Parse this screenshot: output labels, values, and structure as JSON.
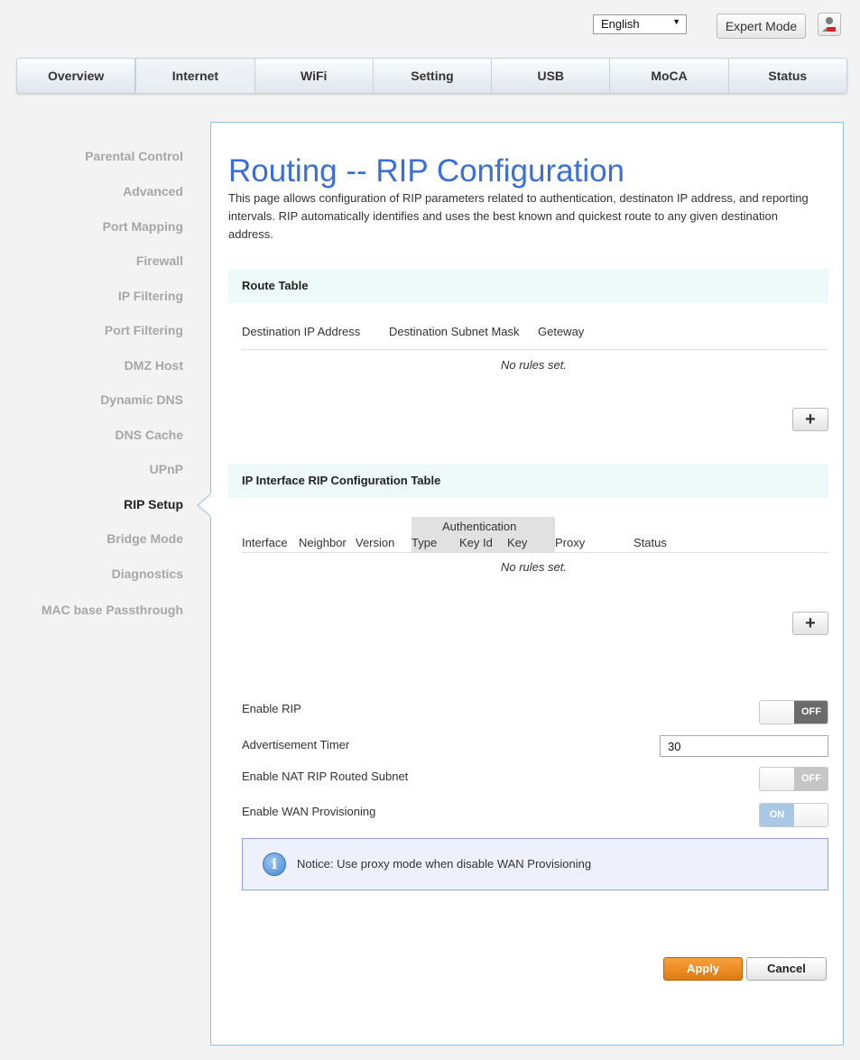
{
  "header": {
    "language": "English",
    "expert_mode_label": "Expert Mode"
  },
  "nav": {
    "tabs": [
      "Overview",
      "Internet",
      "WiFi",
      "Setting",
      "USB",
      "MoCA",
      "Status"
    ],
    "active": "Internet"
  },
  "sidebar": {
    "items": [
      "Parental Control",
      "Advanced",
      "Port Mapping",
      "Firewall",
      "IP Filtering",
      "Port Filtering",
      "DMZ Host",
      "Dynamic DNS",
      "DNS Cache",
      "UPnP",
      "RIP Setup",
      "Bridge Mode",
      "Diagnostics",
      "MAC base Passthrough"
    ],
    "active": "RIP Setup"
  },
  "page": {
    "title": "Routing -- RIP Configuration",
    "description": "This page allows configuration of RIP parameters related to authentication, destinaton IP address, and reporting intervals. RIP automatically identifies and uses the best known and quickest route to any given destination address."
  },
  "route_table": {
    "title": "Route Table",
    "columns": [
      "Destination IP Address",
      "Destination Subnet Mask",
      "Geteway"
    ],
    "empty_text": "No rules set.",
    "add_label": "+"
  },
  "rip_table": {
    "title": "IP Interface RIP Configuration Table",
    "group_header": "Authentication",
    "columns": [
      "Interface",
      "Neighbor",
      "Version",
      "Type",
      "Key Id",
      "Key",
      "Proxy",
      "Status"
    ],
    "empty_text": "No rules set.",
    "add_label": "+"
  },
  "settings": {
    "enable_rip": {
      "label": "Enable RIP",
      "state": "OFF"
    },
    "advertisement_timer": {
      "label": "Advertisement Timer",
      "value": "30"
    },
    "enable_nat": {
      "label": "Enable NAT RIP Routed Subnet",
      "state": "OFF"
    },
    "enable_wan": {
      "label": "Enable WAN Provisioning",
      "state": "ON"
    }
  },
  "notice": {
    "text": "Notice: Use proxy mode when disable WAN Provisioning"
  },
  "actions": {
    "apply": "Apply",
    "cancel": "Cancel"
  },
  "colors": {
    "title_blue": "#3a6ed8",
    "apply_orange": "#e88a1f",
    "panel_border": "#8ec1e5",
    "toggle_on": "#a8c8e6",
    "toggle_off_dark": "#6b6b6b",
    "toggle_off_light": "#c5c5c5"
  }
}
